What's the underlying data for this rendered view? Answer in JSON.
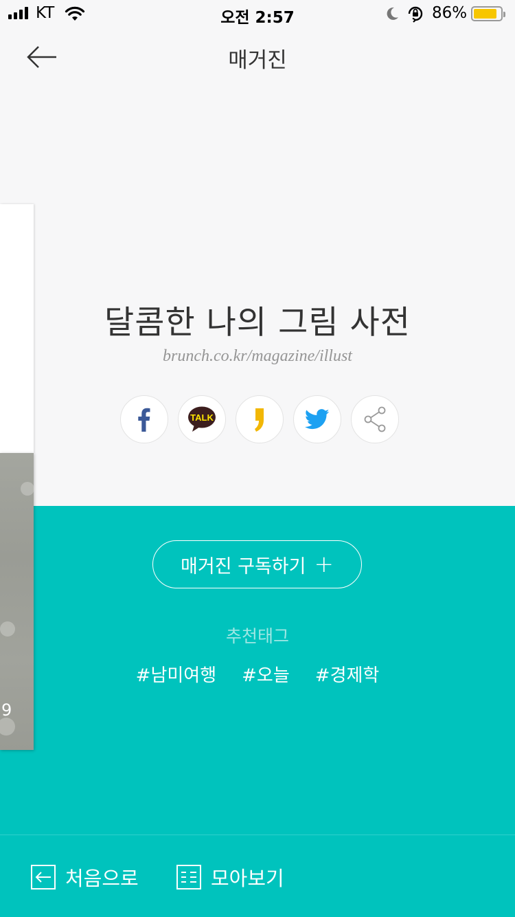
{
  "status_bar": {
    "carrier": "KT",
    "time": "오전 2:57",
    "battery_percent": "86%",
    "battery_level": 0.86
  },
  "header": {
    "title": "매거진"
  },
  "magazine": {
    "title": "달콤한 나의 그림 사전",
    "url": "brunch.co.kr/magazine/illust"
  },
  "share_buttons": [
    {
      "icon": "facebook-icon",
      "color": "#3b5998"
    },
    {
      "icon": "kakaotalk-icon",
      "label": "TALK",
      "color": "#3c1e1e"
    },
    {
      "icon": "kakaostory-icon",
      "color": "#f2b705"
    },
    {
      "icon": "twitter-icon",
      "color": "#1da1f2"
    },
    {
      "icon": "share-icon",
      "color": "#999999"
    }
  ],
  "prev_card": {
    "visible_text": "9"
  },
  "subscribe": {
    "label": "매거진 구독하기",
    "plus": "+"
  },
  "recommended": {
    "label": "추천태그",
    "tags": [
      "#남미여행",
      "#오늘",
      "#경제학"
    ]
  },
  "bottom_nav": {
    "first_label": "처음으로",
    "collection_label": "모아보기"
  },
  "colors": {
    "accent": "#00c3bd",
    "background": "#f7f7f8"
  }
}
